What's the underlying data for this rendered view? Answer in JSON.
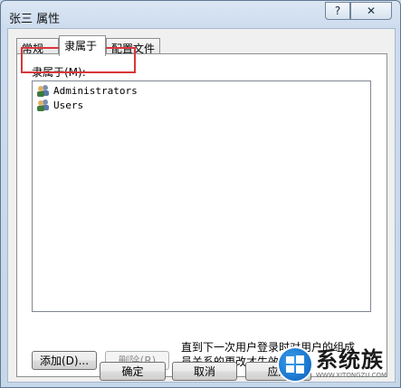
{
  "window": {
    "title": "张三 属性",
    "help_label": "?",
    "close_label": "✕"
  },
  "tabs": [
    {
      "label": "常规"
    },
    {
      "label": "隶属于"
    },
    {
      "label": "配置文件"
    }
  ],
  "members": {
    "label": "隶属于(M):",
    "items": [
      {
        "name": "Administrators",
        "icon": "group-icon"
      },
      {
        "name": "Users",
        "icon": "group-icon"
      }
    ]
  },
  "buttons": {
    "add": "添加(D)...",
    "remove": "删除(R)",
    "ok": "确定",
    "cancel": "取消",
    "apply": "应用"
  },
  "note": "直到下一次用户登录时对用户的组成员关系的更改才生效。",
  "watermark": {
    "title": "系统族",
    "url": "WWW.XITONGZU.COM"
  },
  "colors": {
    "highlight": "#d9363b",
    "accent": "#0b5db8"
  }
}
